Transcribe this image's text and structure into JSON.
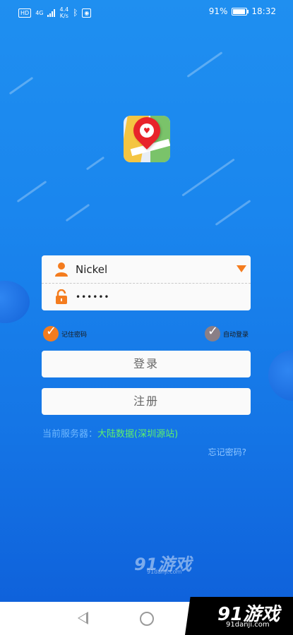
{
  "status_bar": {
    "hd": "HD",
    "net": "4G",
    "speed_value": "4.4",
    "speed_unit": "K/s",
    "battery_text": "91%",
    "battery_level": 0.91,
    "time": "18:32"
  },
  "login": {
    "username": "Nickel",
    "password_mask": "••••••",
    "remember_label": "记住密码",
    "auto_login_label": "自动登录",
    "login_button": "登录",
    "register_button": "注册",
    "server_label": "当前服务器：",
    "server_value": "大陆数据(深圳源站)",
    "forgot_password": "忘记密码?"
  },
  "watermark": {
    "logo": "91游戏",
    "site": "91danji.com"
  },
  "colors": {
    "accent": "#f47c1e",
    "bg_top": "#1f8ff0",
    "bg_bottom": "#0f62db",
    "server_value": "#5ff06a"
  }
}
